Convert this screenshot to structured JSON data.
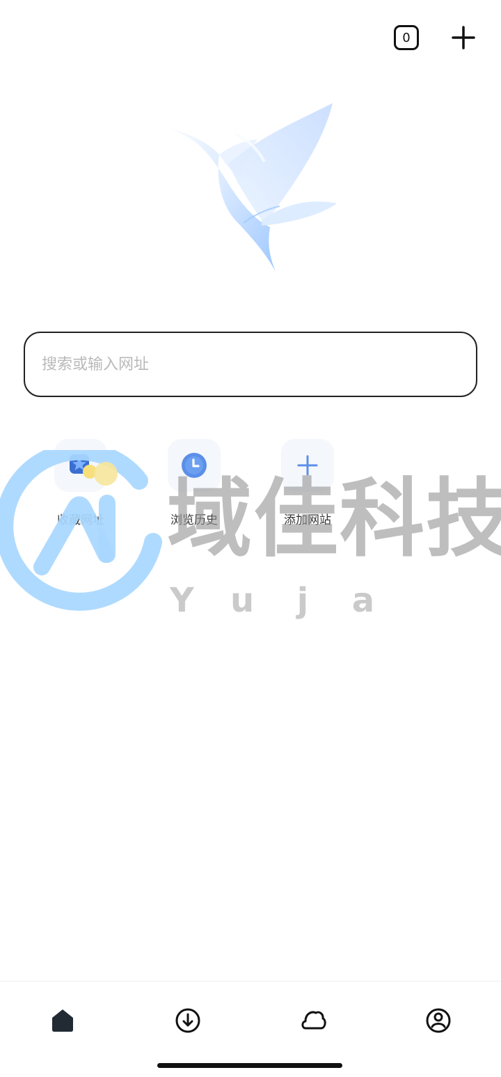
{
  "header": {
    "tab_count": "0"
  },
  "search": {
    "placeholder": "搜索或输入网址",
    "value": ""
  },
  "shortcuts": [
    {
      "label": "收藏网址",
      "icon": "bookmark-star-icon"
    },
    {
      "label": "浏览历史",
      "icon": "history-clock-icon"
    },
    {
      "label": "添加网站",
      "icon": "plus-icon"
    }
  ],
  "watermark": {
    "title": "域佳科技",
    "subtitle_letters": [
      "Y",
      "u",
      "j",
      "a"
    ]
  },
  "bottom_nav": [
    {
      "icon": "home-icon"
    },
    {
      "icon": "download-icon"
    },
    {
      "icon": "cloud-icon"
    },
    {
      "icon": "profile-icon"
    }
  ],
  "colors": {
    "accent": "#5b8fe8",
    "brand_blue": "#b7dcff",
    "watermark_gray": "#9a9a9a"
  }
}
